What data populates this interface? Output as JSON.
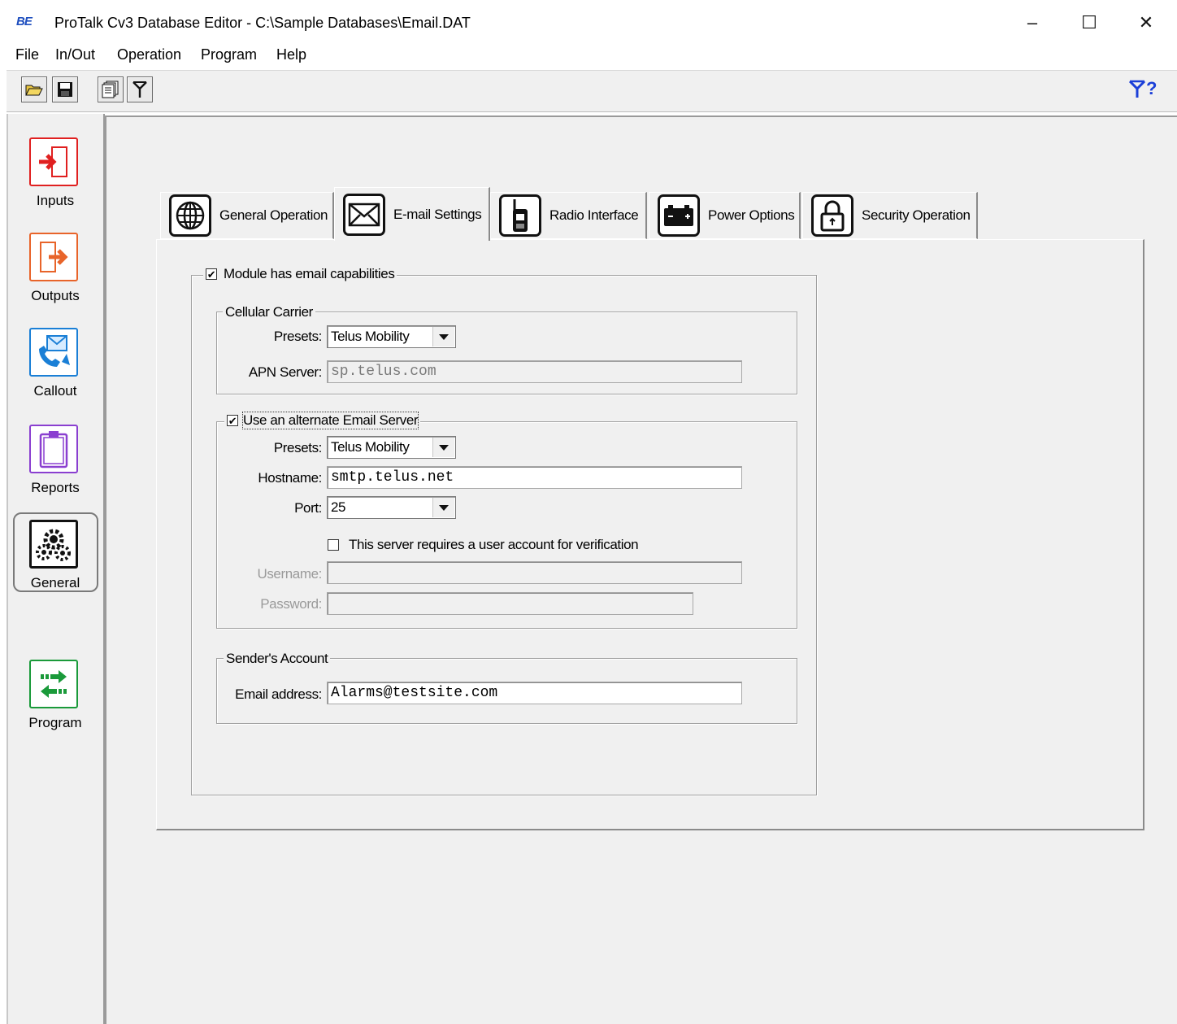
{
  "window": {
    "app_logo": "BE",
    "title": "ProTalk Cv3 Database Editor - C:\\Sample Databases\\Email.DAT",
    "minimize_glyph": "–",
    "maximize_glyph": "☐",
    "close_glyph": "✕"
  },
  "menu": {
    "file": "File",
    "inout": "In/Out",
    "operation": "Operation",
    "program": "Program",
    "help": "Help"
  },
  "toolbar": {
    "icons": [
      "open-folder-icon",
      "save-disk-icon",
      "copy-pages-icon",
      "antenna-icon",
      "help-antenna-icon"
    ],
    "help_glyph": "?"
  },
  "sidenav": {
    "items": [
      {
        "label": "Inputs",
        "icon": "inputs-icon",
        "color": "#e02020"
      },
      {
        "label": "Outputs",
        "icon": "outputs-icon",
        "color": "#e8642a"
      },
      {
        "label": "Callout",
        "icon": "callout-icon",
        "color": "#1a7fd6"
      },
      {
        "label": "Reports",
        "icon": "reports-icon",
        "color": "#8a3fd0"
      },
      {
        "label": "General",
        "icon": "gears-icon",
        "color": "#111111"
      },
      {
        "label": "Program",
        "icon": "program-arrows-icon",
        "color": "#1a9a3a"
      }
    ],
    "selected": "General"
  },
  "tabs": [
    {
      "label": "General Operation",
      "icon": "globe-icon"
    },
    {
      "label": "E-mail Settings",
      "icon": "envelope-icon"
    },
    {
      "label": "Radio Interface",
      "icon": "radio-icon"
    },
    {
      "label": "Power Options",
      "icon": "battery-icon"
    },
    {
      "label": "Security Operation",
      "icon": "lock-icon"
    }
  ],
  "active_tab": "E-mail Settings",
  "email": {
    "module_checkbox": {
      "label": "Module has email capabilities",
      "checked": true
    },
    "carrier": {
      "legend": "Cellular Carrier",
      "presets_label": "Presets:",
      "presets_value": "Telus Mobility",
      "apn_label": "APN Server:",
      "apn_value": "sp.telus.com"
    },
    "alt_server": {
      "checkbox_label": "Use an alternate Email Server",
      "checked": true,
      "presets_label": "Presets:",
      "presets_value": "Telus Mobility",
      "hostname_label": "Hostname:",
      "hostname_value": "smtp.telus.net",
      "port_label": "Port:",
      "port_value": "25",
      "auth_label": "This server requires a user account for verification",
      "auth_checked": false,
      "username_label": "Username:",
      "username_value": "",
      "password_label": "Password:",
      "password_value": ""
    },
    "sender": {
      "legend": "Sender's Account",
      "email_label": "Email address:",
      "email_value": "Alarms@testsite.com"
    }
  }
}
